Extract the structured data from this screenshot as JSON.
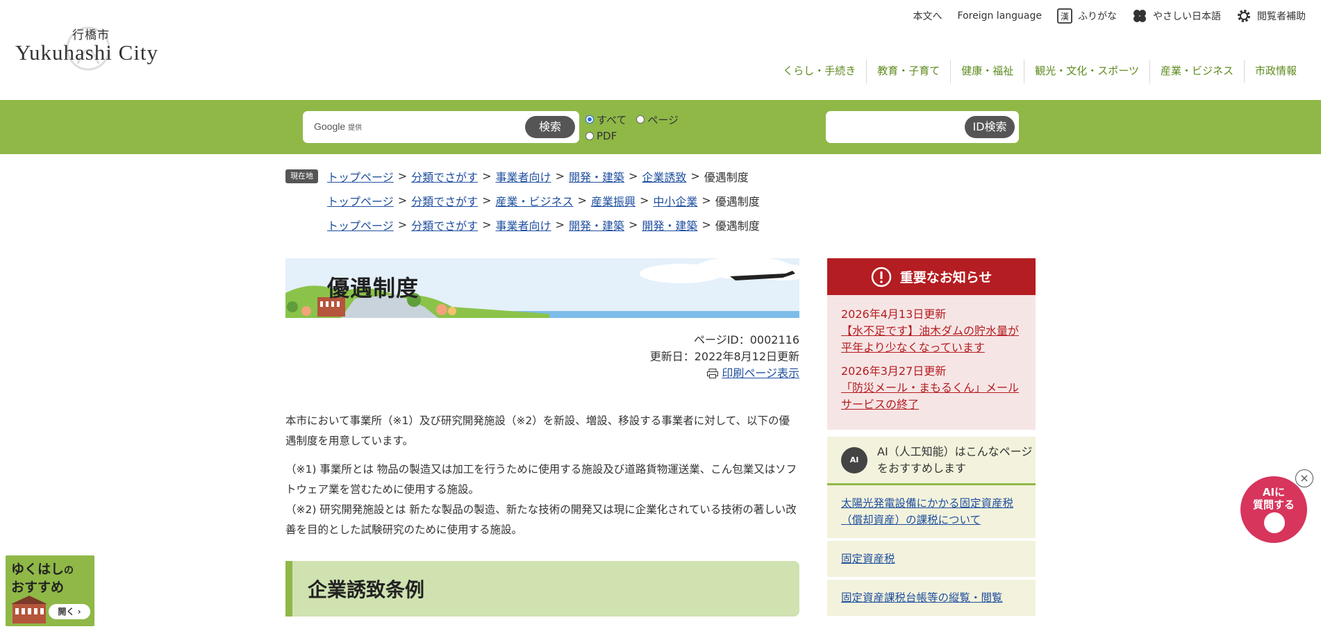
{
  "header": {
    "logo_jp": "行橋市",
    "logo_en": "Yukuhashi City",
    "util": {
      "to_main": "本文へ",
      "foreign": "Foreign language",
      "furigana": "ふりがな",
      "easy_japanese": "やさしい日本語",
      "accessibility": "閲覧者補助"
    },
    "global_nav": [
      "くらし・手続き",
      "教育・子育て",
      "健康・福祉",
      "観光・文化・スポーツ",
      "産業・ビジネス",
      "市政情報"
    ]
  },
  "search": {
    "google_label": "Google",
    "google_sub": "提供",
    "search_button": "検索",
    "scope_all": "すべて",
    "scope_page": "ページ",
    "scope_pdf": "PDF",
    "id_button": "ID検索"
  },
  "breadcrumbs": {
    "here_label": "現在地",
    "trails": [
      [
        "トップページ",
        "分類でさがす",
        "事業者向け",
        "開発・建築",
        "企業誘致",
        "優遇制度"
      ],
      [
        "トップページ",
        "分類でさがす",
        "産業・ビジネス",
        "産業振興",
        "中小企業",
        "優遇制度"
      ],
      [
        "トップページ",
        "分類でさがす",
        "事業者向け",
        "開発・建築",
        "開発・建築",
        "優遇制度"
      ]
    ],
    "separator": ">"
  },
  "page": {
    "title": "優遇制度",
    "page_id": "ページID：0002116",
    "updated": "更新日：2022年8月12日更新",
    "print_link": "印刷ページ表示",
    "intro": "本市において事業所（※1）及び研究開発施設（※2）を新設、増設、移設する事業者に対して、以下の優遇制度を用意しています。",
    "note1": "（※1) 事業所とは 物品の製造又は加工を行うために使用する施設及び道路貨物運送業、こん包業又はソフトウェア業を営むために使用する施設。",
    "note2": "（※2) 研究開発施設とは 新たな製品の製造、新たな技術の開発又は現に企業化されている技術の著しい改善を目的とした試験研究のために使用する施設。",
    "section_heading": "企業誘致条例"
  },
  "sidebar": {
    "notice_title": "重要なお知らせ",
    "notices": [
      {
        "date": "2026年4月13日更新",
        "text": "【水不足です】油木ダムの貯水量が平年より少なくなっています"
      },
      {
        "date": "2026年3月27日更新",
        "text": "「防災メール・まもるくん」メールサービスの終了"
      }
    ],
    "ai_icon": "AI",
    "ai_title": "AI（人工知能）はこんなページをおすすめします",
    "ai_links": [
      "太陽光発電設備にかかる固定資産税（償却資産）の課税について",
      "固定資産税",
      "固定資産課税台帳等の縦覧・閲覧"
    ]
  },
  "floating": {
    "reco_line1": "ゆくはし",
    "reco_no": "の",
    "reco_line2": "おすすめ",
    "reco_open": "開く",
    "ai_line1": "AIに",
    "ai_line2": "質問する",
    "close": "×"
  },
  "colors": {
    "brand_green": "#8fb847",
    "nav_green": "#5e8b1f",
    "alert_red": "#b41d21",
    "ai_pink": "#d7355c"
  }
}
